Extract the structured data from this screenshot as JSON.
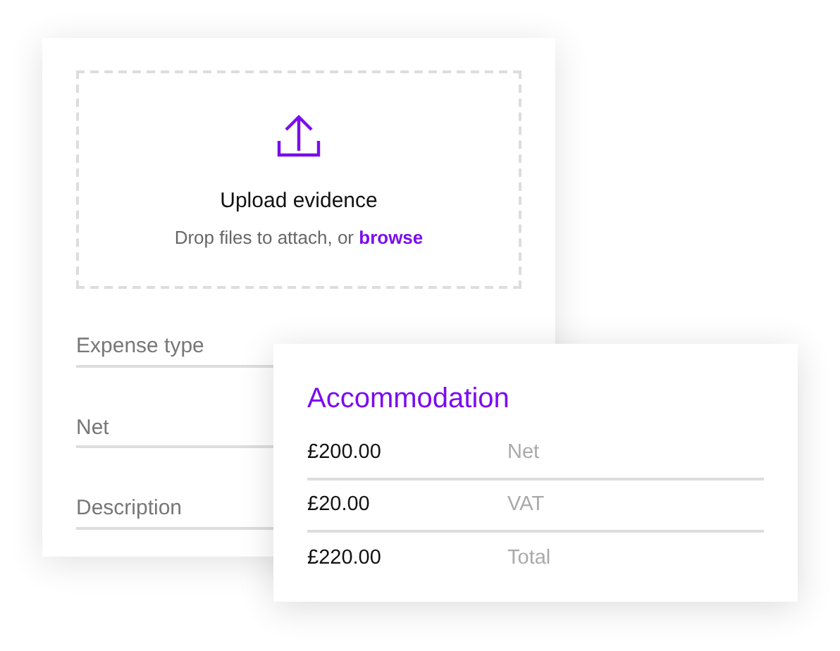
{
  "upload": {
    "title": "Upload evidence",
    "hint": "Drop files to attach, or ",
    "link": "browse"
  },
  "fields": [
    {
      "placeholder": "Expense type"
    },
    {
      "placeholder": "Net"
    },
    {
      "placeholder": "Description"
    }
  ],
  "summary": {
    "title": "Accommodation",
    "rows": [
      {
        "amount": "£200.00",
        "label": "Net"
      },
      {
        "amount": "£20.00",
        "label": "VAT"
      },
      {
        "amount": "£220.00",
        "label": "Total"
      }
    ]
  }
}
